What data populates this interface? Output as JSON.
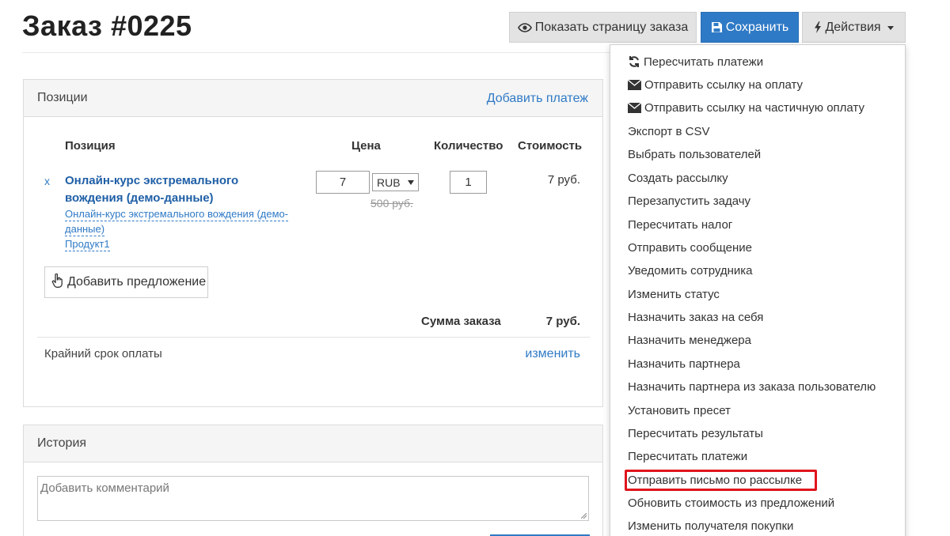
{
  "page": {
    "title": "Заказ #0225"
  },
  "toolbar": {
    "view_label": "Показать страницу заказа",
    "save_label": "Сохранить",
    "actions_label": "Действия"
  },
  "positions_panel": {
    "title": "Позиции",
    "add_payment": "Добавить платеж",
    "columns": {
      "position": "Позиция",
      "price": "Цена",
      "quantity": "Количество",
      "cost": "Стоимость"
    },
    "item": {
      "remove": "x",
      "name": "Онлайн-курс экстремального вождения (демо-данные)",
      "link_line1": "Онлайн-курс экстремального вождения (демо-",
      "link_line2": "данные)",
      "product_link": "Продукт1",
      "price": "7",
      "currency": "RUB",
      "old_price": "500 руб.",
      "quantity": "1",
      "total": "7 руб."
    },
    "add_offer": "Добавить предложение",
    "sum_label": "Сумма заказа",
    "sum_value": "7 руб.",
    "deadline_label": "Крайний срок оплаты",
    "deadline_change": "изменить"
  },
  "history_panel": {
    "title": "История",
    "comment_placeholder": "Добавить комментарий"
  },
  "actions_menu": {
    "items": [
      {
        "label": "Пересчитать платежи",
        "icon": "refresh-icon"
      },
      {
        "label": "Отправить ссылку на оплату",
        "icon": "envelope-icon"
      },
      {
        "label": "Отправить ссылку на частичную оплату",
        "icon": "envelope-icon"
      },
      {
        "label": "Экспорт в CSV"
      },
      {
        "label": "Выбрать пользователей"
      },
      {
        "label": "Создать рассылку"
      },
      {
        "label": "Перезапустить задачу"
      },
      {
        "label": "Пересчитать налог"
      },
      {
        "label": "Отправить сообщение"
      },
      {
        "label": "Уведомить сотрудника"
      },
      {
        "label": "Изменить статус"
      },
      {
        "label": "Назначить заказ на себя"
      },
      {
        "label": "Назначить менеджера"
      },
      {
        "label": "Назначить партнера"
      },
      {
        "label": "Назначить партнера из заказа пользователю"
      },
      {
        "label": "Установить пресет"
      },
      {
        "label": "Пересчитать результаты"
      },
      {
        "label": "Пересчитать платежи"
      },
      {
        "label": "Отправить письмо по рассылке",
        "highlighted": true
      },
      {
        "label": "Обновить стоимость из предложений"
      },
      {
        "label": "Изменить получателя покупки"
      }
    ]
  },
  "colors": {
    "accent": "#2f7ac6",
    "highlight": "#e0151c"
  }
}
